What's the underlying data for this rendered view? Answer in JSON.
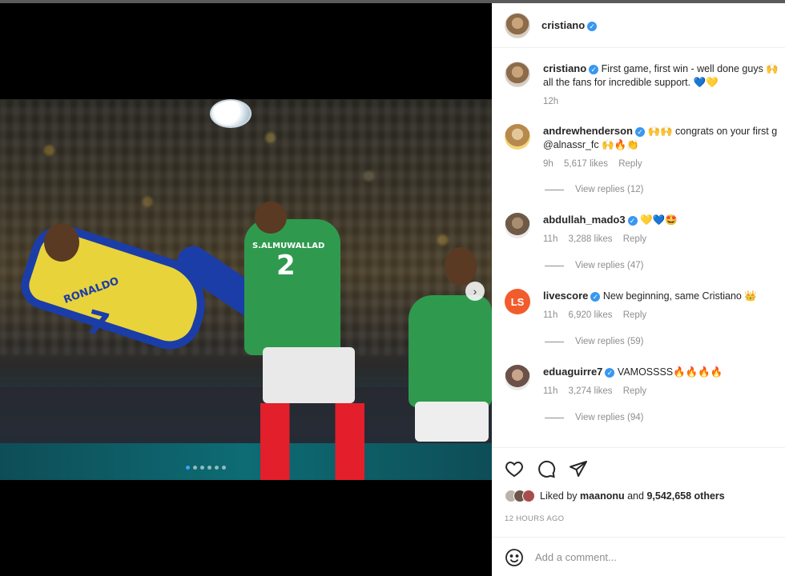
{
  "post": {
    "author": "cristiano",
    "caption_line1": "First game, first win - well done guys 🙌",
    "caption_line2": "all the fans for incredible support. 💙💛",
    "caption_time": "12h"
  },
  "media": {
    "jersey_name": "RONALDO",
    "jersey_number": "7",
    "opponent_name": "S.ALMUWALLAD",
    "opponent_number": "2",
    "next_icon": "chevron-right-icon",
    "carousel_count": 6,
    "carousel_active": 1
  },
  "comments": [
    {
      "username": "andrewhenderson",
      "text_line1": "🙌🙌 congrats on your first g",
      "text_line2": "@alnassr_fc 🙌🔥👏",
      "time": "9h",
      "likes": "5,617 likes",
      "reply": "Reply",
      "view_replies": "View replies (12)"
    },
    {
      "username": "abdullah_mado3",
      "text_line1": "💛💙🤩",
      "time": "11h",
      "likes": "3,288 likes",
      "reply": "Reply",
      "view_replies": "View replies (47)"
    },
    {
      "username": "livescore",
      "avatar_text": "LS",
      "text_line1": "New beginning, same Cristiano 👑",
      "time": "11h",
      "likes": "6,920 likes",
      "reply": "Reply",
      "view_replies": "View replies (59)"
    },
    {
      "username": "eduaguirre7",
      "text_line1": "VAMOSSSS🔥🔥🔥🔥",
      "time": "11h",
      "likes": "3,274 likes",
      "reply": "Reply",
      "view_replies": "View replies (94)"
    }
  ],
  "footer": {
    "liked_prefix": "Liked by",
    "liked_user": "maanonu",
    "liked_suffix": "and",
    "liked_others": "9,542,658 others",
    "timestamp": "12 HOURS AGO",
    "comment_placeholder": "Add a comment...",
    "icons": [
      "heart-icon",
      "comment-icon",
      "share-icon",
      "emoji-icon"
    ]
  },
  "colors": {
    "verified": "#3897f0",
    "livescore": "#f25c2c",
    "text_secondary": "#8e8e8e"
  }
}
